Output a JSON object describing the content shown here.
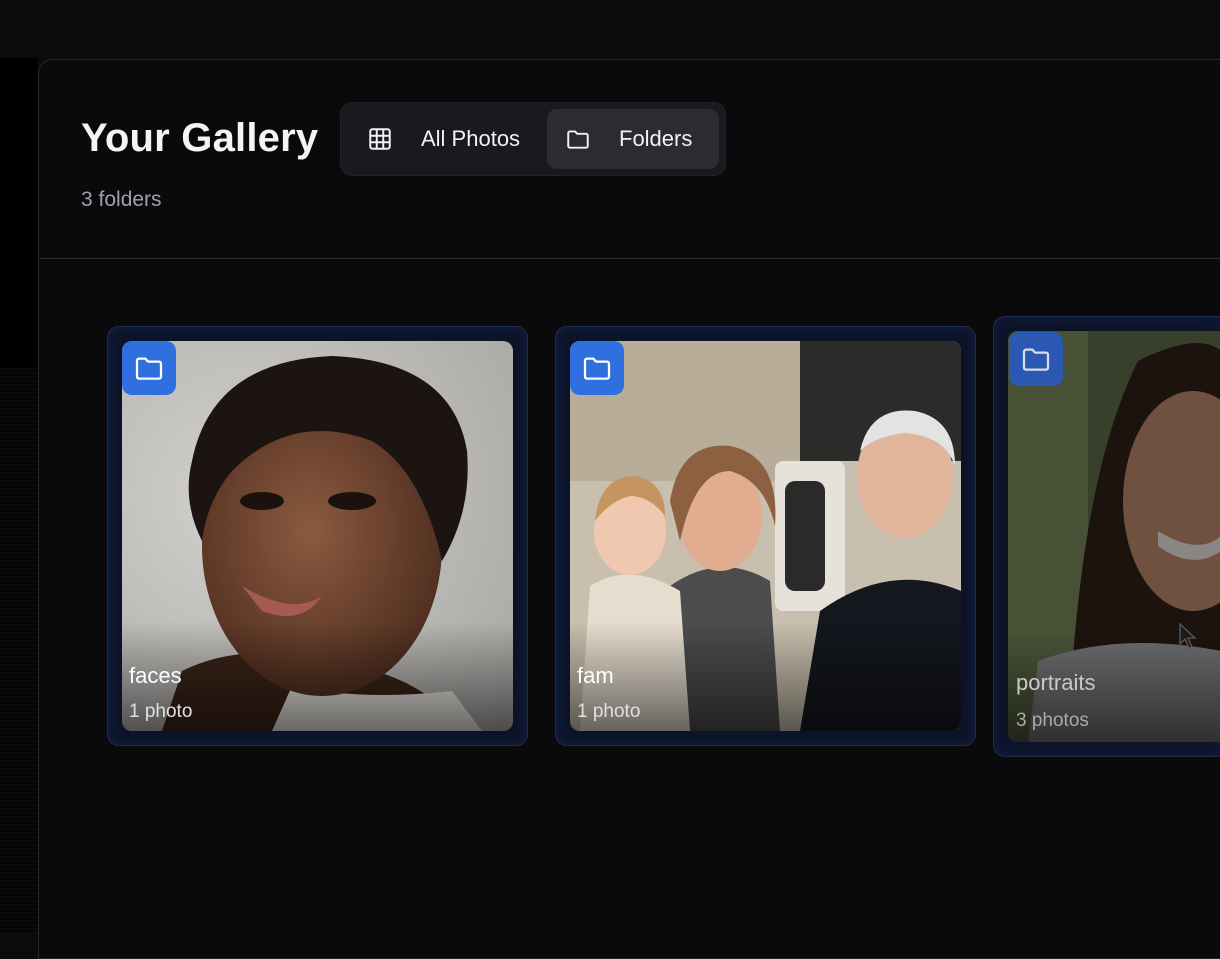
{
  "header": {
    "title": "Your Gallery",
    "subtitle": "3 folders"
  },
  "view_toggle": {
    "all_photos_label": "All Photos",
    "all_photos_icon": "grid-icon",
    "folders_label": "Folders",
    "folders_icon": "folder-icon",
    "selected": "Folders"
  },
  "folders": [
    {
      "name": "faces",
      "count": "1 photo",
      "icon": "folder-icon"
    },
    {
      "name": "fam",
      "count": "1 photo",
      "icon": "folder-icon"
    },
    {
      "name": "portraits",
      "count": "3 photos",
      "icon": "folder-icon"
    }
  ],
  "colors": {
    "accent": "#2f6fe0",
    "background": "#0a0a0c",
    "card_background": "#0c1428"
  }
}
